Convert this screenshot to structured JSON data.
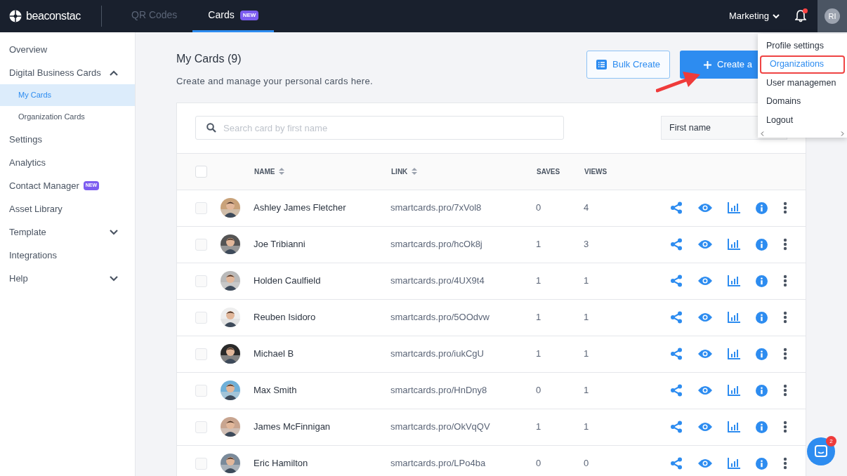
{
  "header": {
    "logo": "beaconstac",
    "tabs": [
      {
        "label": "QR Codes",
        "selected": false
      },
      {
        "label": "Cards",
        "selected": true,
        "badge": "NEW"
      }
    ],
    "workspace": "Marketing",
    "notification_dot": true,
    "avatar": "RI"
  },
  "sidebar": {
    "items": [
      {
        "label": "Overview"
      },
      {
        "label": "Digital Business Cards",
        "expanded": true,
        "children": [
          {
            "label": "My Cards",
            "selected": true
          },
          {
            "label": "Organization Cards",
            "selected": false
          }
        ]
      },
      {
        "label": "Settings"
      },
      {
        "label": "Analytics"
      },
      {
        "label": "Contact Manager",
        "badge": "NEW"
      },
      {
        "label": "Asset Library"
      },
      {
        "label": "Template",
        "expanded": false
      },
      {
        "label": "Integrations"
      },
      {
        "label": "Help",
        "expanded": false
      }
    ]
  },
  "page": {
    "title": "My Cards (9)",
    "subtitle": "Create and manage your personal cards here.",
    "bulk_button": "Bulk Create",
    "create_button": "Create a"
  },
  "search": {
    "placeholder": "Search card by first name"
  },
  "sort_select": {
    "value": "First name"
  },
  "table": {
    "select_all": {
      "checked": false
    },
    "columns": [
      {
        "label": "NAME",
        "sortable": true
      },
      {
        "label": "LINK",
        "sortable": true
      },
      {
        "label": "SAVES",
        "sortable": false
      },
      {
        "label": "VIEWS",
        "sortable": false
      }
    ],
    "rows": [
      {
        "name": "Ashley James Fletcher",
        "link": "smartcards.pro/7xVol8",
        "saves": "0",
        "views": "4",
        "color": "#c9a27a",
        "checked": false
      },
      {
        "name": "Joe Tribianni",
        "link": "smartcards.pro/hcOk8j",
        "saves": "1",
        "views": "3",
        "color": "#555555",
        "checked": false
      },
      {
        "name": "Holden Caulfield",
        "link": "smartcards.pro/4UX9t4",
        "saves": "1",
        "views": "1",
        "color": "#b9b9b9",
        "checked": false
      },
      {
        "name": "Reuben Isidoro",
        "link": "smartcards.pro/5OOdvw",
        "saves": "1",
        "views": "1",
        "color": "#eeeeee",
        "checked": false
      },
      {
        "name": "Michael B",
        "link": "smartcards.pro/iukCgU",
        "saves": "1",
        "views": "1",
        "color": "#2a2a2a",
        "checked": false
      },
      {
        "name": "Max Smith",
        "link": "smartcards.pro/HnDny8",
        "saves": "0",
        "views": "1",
        "color": "#6fb0d8",
        "checked": false
      },
      {
        "name": "James McFinnigan",
        "link": "smartcards.pro/OkVqQV",
        "saves": "1",
        "views": "1",
        "color": "#c8a590",
        "checked": false
      },
      {
        "name": "Eric Hamilton",
        "link": "smartcards.pro/LPo4ba",
        "saves": "0",
        "views": "0",
        "color": "#7a8a9a",
        "checked": false
      }
    ]
  },
  "profile_menu": {
    "items": [
      {
        "label": "Profile settings",
        "highlighted": false
      },
      {
        "label": "Organizations",
        "highlighted": true
      },
      {
        "label": "User managemen",
        "highlighted": false
      },
      {
        "label": "Domains",
        "highlighted": false
      },
      {
        "label": "Logout",
        "highlighted": false
      }
    ]
  },
  "chat": {
    "badge": "2"
  }
}
